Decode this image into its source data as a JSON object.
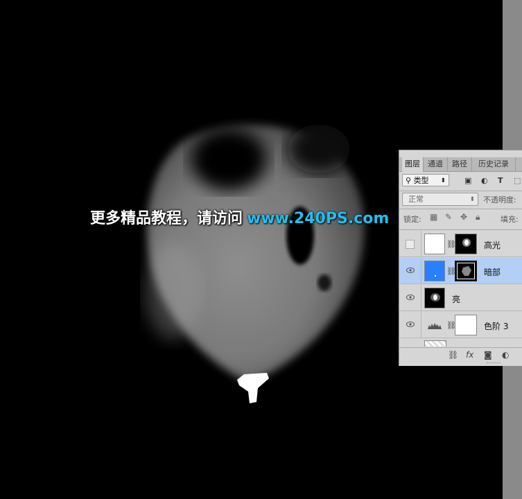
{
  "watermark": {
    "text_cn": "更多精品教程，请访问",
    "text_url": "www.240PS.com"
  },
  "layers_panel": {
    "tabs": [
      "图层",
      "通道",
      "路径",
      "历史记录"
    ],
    "active_tab": "图层",
    "filter": {
      "selected": "类型",
      "search_icon": "search-icon"
    },
    "filter_icons": [
      "image-icon",
      "adjustment-icon",
      "text-icon",
      "shape-icon"
    ],
    "blend_mode": "正常",
    "opacity_label": "不透明度:",
    "lock_label": "锁定:",
    "lock_icons": [
      "lock-transparent-icon",
      "lock-paint-icon",
      "lock-move-icon",
      "lock-all-icon"
    ],
    "fill_label": "填充:",
    "layers": [
      {
        "name": "高光",
        "visible": false,
        "selected": false
      },
      {
        "name": "暗部",
        "visible": true,
        "selected": true
      },
      {
        "name": "亮",
        "visible": true,
        "selected": false
      },
      {
        "name": "色阶 3",
        "visible": true,
        "selected": false
      }
    ],
    "bottom_icons": [
      "link-layers-icon",
      "fx-icon",
      "add-mask-icon",
      "new-adjustment-icon"
    ],
    "fx_label": "fx"
  },
  "colors": {
    "canvas_bg": "#000000",
    "panel_bg": "#d6d6d6",
    "selected_row": "#b3cff5",
    "thumb_blue": "#2a7fff",
    "watermark_url": "#1fc0f0"
  }
}
